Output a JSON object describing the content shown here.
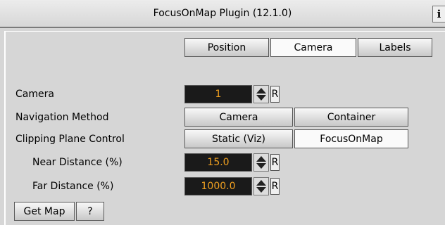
{
  "title": "FocusOnMap Plugin (12.1.0)",
  "info_icon": "i",
  "tabs": [
    {
      "label": "Position",
      "active": false
    },
    {
      "label": "Camera",
      "active": true
    },
    {
      "label": "Labels",
      "active": false
    }
  ],
  "rows": {
    "camera": {
      "label": "Camera",
      "value": "1",
      "reset": "R"
    },
    "navigation": {
      "label": "Navigation Method",
      "options": [
        "Camera",
        "Container"
      ],
      "selected": "Camera"
    },
    "clipping": {
      "label": "Clipping Plane Control",
      "options": [
        "Static (Viz)",
        "FocusOnMap"
      ],
      "selected": "FocusOnMap"
    },
    "near": {
      "label": "Near Distance (%)",
      "value": "15.0",
      "reset": "R"
    },
    "far": {
      "label": "Far Distance (%)",
      "value": "1000.0",
      "reset": "R"
    }
  },
  "actions": {
    "get_map": "Get Map",
    "help": "?"
  },
  "colors": {
    "background": "#d6d6d6",
    "field_bg": "#1a1a1a",
    "field_text": "#f0a020"
  }
}
